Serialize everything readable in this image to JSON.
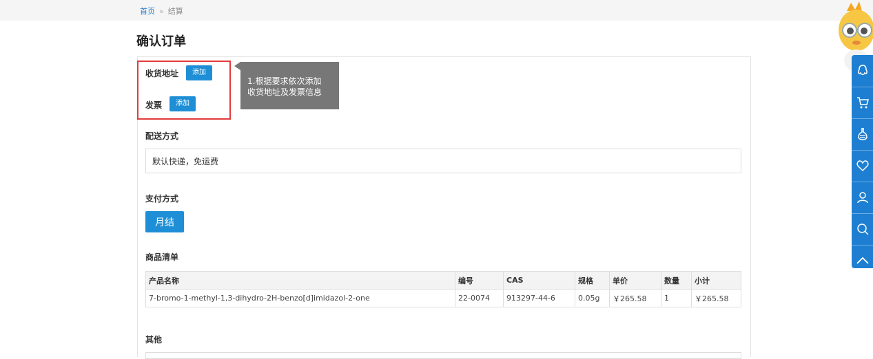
{
  "breadcrumb": {
    "home": "首页",
    "separator": "»",
    "current": "结算"
  },
  "page_title": "确认订单",
  "address": {
    "label": "收货地址",
    "add_label": "添加"
  },
  "invoice": {
    "label": "发票",
    "add_label": "添加"
  },
  "tooltip": {
    "line1": "1.根据要求依次添加",
    "line2": "收货地址及发票信息"
  },
  "delivery": {
    "label": "配送方式",
    "value": "默认快递，免运费"
  },
  "payment": {
    "label": "支付方式",
    "option": "月结"
  },
  "goods": {
    "label": "商品清单",
    "columns": [
      "产品名称",
      "编号",
      "CAS",
      "规格",
      "单价",
      "数量",
      "小计"
    ],
    "rows": [
      [
        "7-bromo-1-methyl-1,3-dihydro-2H-benzo[d]imidazol-2-one",
        "22-0074",
        "913297-44-6",
        "0.05g",
        "￥265.58",
        "1",
        "￥265.58"
      ]
    ]
  },
  "other": {
    "label": "其他"
  },
  "sidebar": {
    "icons": [
      "qq-icon",
      "cart-icon",
      "flask-icon",
      "heart-icon",
      "user-icon",
      "search-icon",
      "arrow-up-icon"
    ]
  },
  "colors": {
    "accent": "#1e8fd6",
    "highlight": "#e23b3b",
    "tooltip": "#777777",
    "sidebar": "#1e7fd2"
  }
}
